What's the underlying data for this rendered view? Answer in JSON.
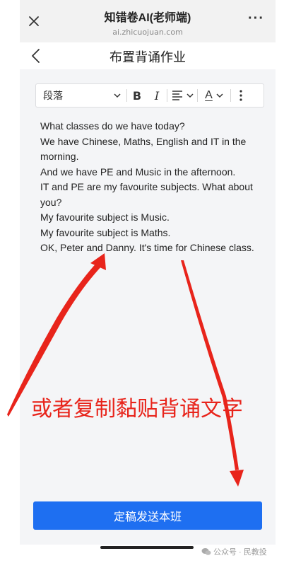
{
  "topbar": {
    "title": "知错卷AI(老师端)",
    "url": "ai.zhicuojuan.com",
    "close_icon": "close-icon",
    "more_icon": "more-dots-icon"
  },
  "header": {
    "title": "布置背诵作业",
    "back_icon": "chevron-left-icon"
  },
  "toolbar": {
    "paragraph_label": "段落",
    "bold_label": "B",
    "italic_label": "I",
    "align_icon": "align-left-icon",
    "font_color_label": "A",
    "more_icon": "vertical-dots-icon"
  },
  "editor": {
    "lines": [
      "What classes do we have today?",
      "We have Chinese, Maths, English and IT in the morning.",
      "And we have PE and Music in the afternoon.",
      "IT and PE are my favourite subjects. What about you?",
      "My favourite subject is Music.",
      "My favourite subject is Maths.",
      "OK, Peter and Danny. It's time for Chinese class."
    ]
  },
  "annotation": {
    "text": "或者复制黏贴背诵文字",
    "color": "#e8241b"
  },
  "submit": {
    "label": "定稿发送本班",
    "color": "#1e6ff1"
  },
  "watermark": {
    "text": "公众号 · 民教投"
  }
}
